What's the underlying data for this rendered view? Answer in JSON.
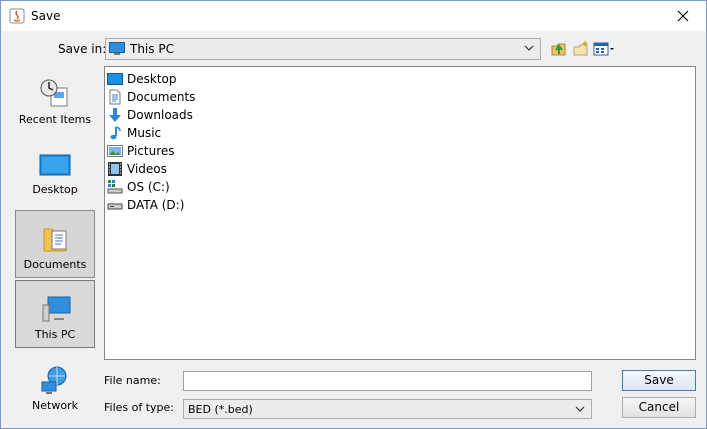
{
  "window": {
    "title": "Save"
  },
  "save_in": {
    "label": "Save in:",
    "selected": "This PC",
    "selected_icon": "monitor-icon"
  },
  "toolbar": {
    "up_icon": "up-folder-icon",
    "new_folder_icon": "new-folder-icon",
    "view_icon": "view-menu-icon"
  },
  "sidebar": {
    "items": [
      {
        "label": "Recent Items",
        "icon": "recent-items-icon"
      },
      {
        "label": "Desktop",
        "icon": "desktop-icon"
      },
      {
        "label": "Documents",
        "icon": "documents-icon"
      },
      {
        "label": "This PC",
        "icon": "this-pc-icon",
        "selected": true
      },
      {
        "label": "Network",
        "icon": "network-icon"
      }
    ]
  },
  "files": [
    {
      "name": "Desktop",
      "icon": "desktop-icon"
    },
    {
      "name": "Documents",
      "icon": "document-icon"
    },
    {
      "name": "Downloads",
      "icon": "download-icon"
    },
    {
      "name": "Music",
      "icon": "music-icon"
    },
    {
      "name": "Pictures",
      "icon": "pictures-icon"
    },
    {
      "name": "Videos",
      "icon": "videos-icon"
    },
    {
      "name": "OS (C:)",
      "icon": "os-drive-icon"
    },
    {
      "name": "DATA (D:)",
      "icon": "drive-icon"
    }
  ],
  "file_name": {
    "label": "File name:",
    "value": ""
  },
  "file_type": {
    "label": "Files of type:",
    "selected": "BED (*.bed)"
  },
  "buttons": {
    "save": "Save",
    "cancel": "Cancel"
  }
}
